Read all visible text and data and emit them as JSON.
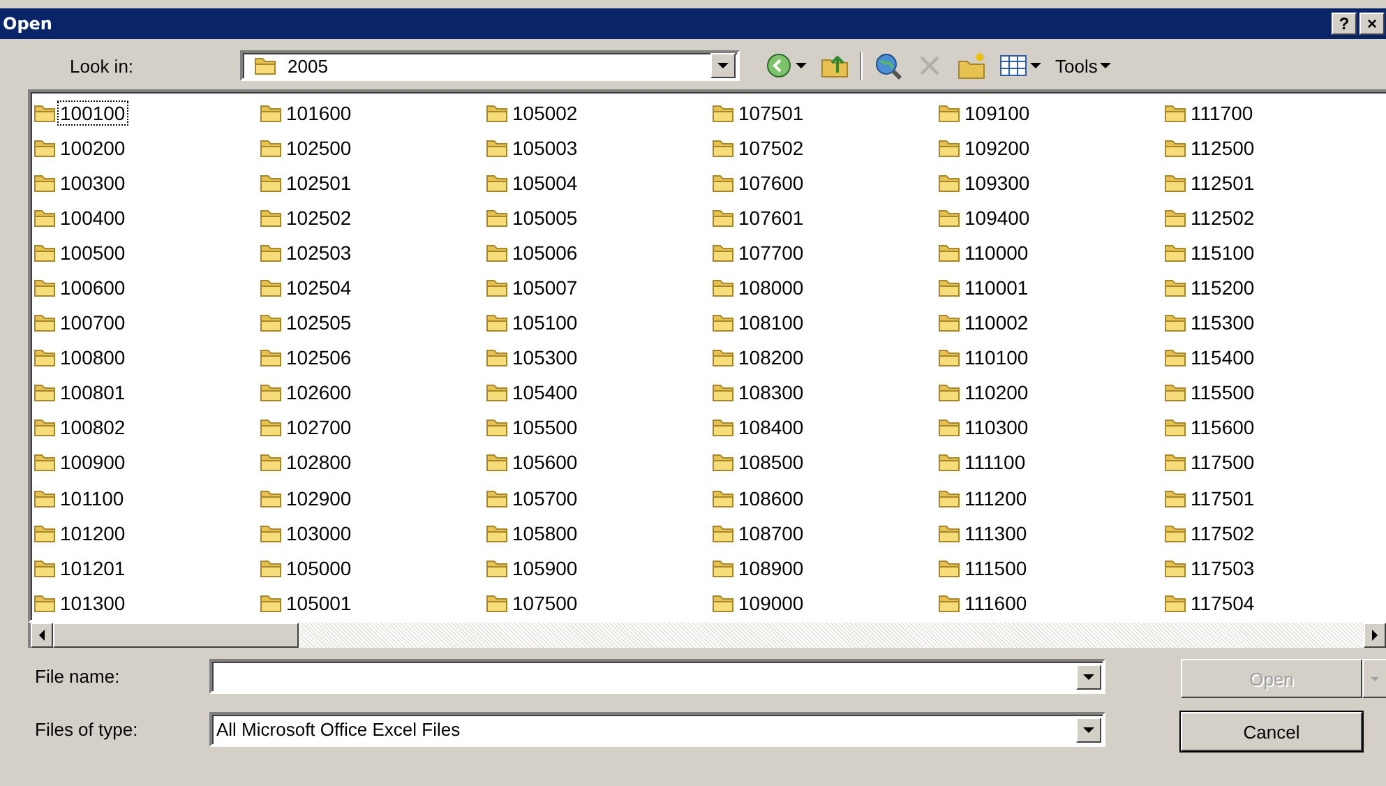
{
  "window": {
    "title": "Open",
    "buttons": [
      "?",
      "×"
    ]
  },
  "look_in": {
    "label": "Look in:",
    "value": "2005"
  },
  "toolbar": [
    {
      "kind": "back",
      "disabled": false
    },
    {
      "kind": "up",
      "disabled": false
    },
    {
      "kind": "search-web",
      "disabled": false
    },
    {
      "kind": "delete",
      "disabled": true
    },
    {
      "kind": "new-folder",
      "disabled": false
    },
    {
      "kind": "views",
      "disabled": false
    },
    {
      "kind": "tools",
      "label": "Tools",
      "disabled": false
    }
  ],
  "folders": [
    {
      "name": "100100",
      "focused": true
    },
    {
      "name": "100200",
      "focused": false
    },
    {
      "name": "100300",
      "focused": false
    },
    {
      "name": "100400",
      "focused": false
    },
    {
      "name": "100500",
      "focused": false
    },
    {
      "name": "100600",
      "focused": false
    },
    {
      "name": "100700",
      "focused": false
    },
    {
      "name": "100800",
      "focused": false
    },
    {
      "name": "100801",
      "focused": false
    },
    {
      "name": "100802",
      "focused": false
    },
    {
      "name": "100900",
      "focused": false
    },
    {
      "name": "101100",
      "focused": false
    },
    {
      "name": "101200",
      "focused": false
    },
    {
      "name": "101201",
      "focused": false
    },
    {
      "name": "101300",
      "focused": false
    },
    {
      "name": "101600",
      "focused": false
    },
    {
      "name": "102500",
      "focused": false
    },
    {
      "name": "102501",
      "focused": false
    },
    {
      "name": "102502",
      "focused": false
    },
    {
      "name": "102503",
      "focused": false
    },
    {
      "name": "102504",
      "focused": false
    },
    {
      "name": "102505",
      "focused": false
    },
    {
      "name": "102506",
      "focused": false
    },
    {
      "name": "102600",
      "focused": false
    },
    {
      "name": "102700",
      "focused": false
    },
    {
      "name": "102800",
      "focused": false
    },
    {
      "name": "102900",
      "focused": false
    },
    {
      "name": "103000",
      "focused": false
    },
    {
      "name": "105000",
      "focused": false
    },
    {
      "name": "105001",
      "focused": false
    },
    {
      "name": "105002",
      "focused": false
    },
    {
      "name": "105003",
      "focused": false
    },
    {
      "name": "105004",
      "focused": false
    },
    {
      "name": "105005",
      "focused": false
    },
    {
      "name": "105006",
      "focused": false
    },
    {
      "name": "105007",
      "focused": false
    },
    {
      "name": "105100",
      "focused": false
    },
    {
      "name": "105300",
      "focused": false
    },
    {
      "name": "105400",
      "focused": false
    },
    {
      "name": "105500",
      "focused": false
    },
    {
      "name": "105600",
      "focused": false
    },
    {
      "name": "105700",
      "focused": false
    },
    {
      "name": "105800",
      "focused": false
    },
    {
      "name": "105900",
      "focused": false
    },
    {
      "name": "107500",
      "focused": false
    },
    {
      "name": "107501",
      "focused": false
    },
    {
      "name": "107502",
      "focused": false
    },
    {
      "name": "107600",
      "focused": false
    },
    {
      "name": "107601",
      "focused": false
    },
    {
      "name": "107700",
      "focused": false
    },
    {
      "name": "108000",
      "focused": false
    },
    {
      "name": "108100",
      "focused": false
    },
    {
      "name": "108200",
      "focused": false
    },
    {
      "name": "108300",
      "focused": false
    },
    {
      "name": "108400",
      "focused": false
    },
    {
      "name": "108500",
      "focused": false
    },
    {
      "name": "108600",
      "focused": false
    },
    {
      "name": "108700",
      "focused": false
    },
    {
      "name": "108900",
      "focused": false
    },
    {
      "name": "109000",
      "focused": false
    },
    {
      "name": "109100",
      "focused": false
    },
    {
      "name": "109200",
      "focused": false
    },
    {
      "name": "109300",
      "focused": false
    },
    {
      "name": "109400",
      "focused": false
    },
    {
      "name": "110000",
      "focused": false
    },
    {
      "name": "110001",
      "focused": false
    },
    {
      "name": "110002",
      "focused": false
    },
    {
      "name": "110100",
      "focused": false
    },
    {
      "name": "110200",
      "focused": false
    },
    {
      "name": "110300",
      "focused": false
    },
    {
      "name": "111100",
      "focused": false
    },
    {
      "name": "111200",
      "focused": false
    },
    {
      "name": "111300",
      "focused": false
    },
    {
      "name": "111500",
      "focused": false
    },
    {
      "name": "111600",
      "focused": false
    },
    {
      "name": "111700",
      "focused": false
    },
    {
      "name": "112500",
      "focused": false
    },
    {
      "name": "112501",
      "focused": false
    },
    {
      "name": "112502",
      "focused": false
    },
    {
      "name": "115100",
      "focused": false
    },
    {
      "name": "115200",
      "focused": false
    },
    {
      "name": "115300",
      "focused": false
    },
    {
      "name": "115400",
      "focused": false
    },
    {
      "name": "115500",
      "focused": false
    },
    {
      "name": "115600",
      "focused": false
    },
    {
      "name": "117500",
      "focused": false
    },
    {
      "name": "117501",
      "focused": false
    },
    {
      "name": "117502",
      "focused": false
    },
    {
      "name": "117503",
      "focused": false
    },
    {
      "name": "117504",
      "focused": false
    }
  ],
  "file_name": {
    "label": "File name:"
  },
  "file_type": {
    "label": "Files of type:",
    "value": "All Microsoft Office Excel Files"
  },
  "buttons": [
    {
      "label": "Open",
      "disabled": true,
      "split": true
    },
    {
      "label": "Cancel",
      "disabled": false,
      "split": false
    }
  ]
}
